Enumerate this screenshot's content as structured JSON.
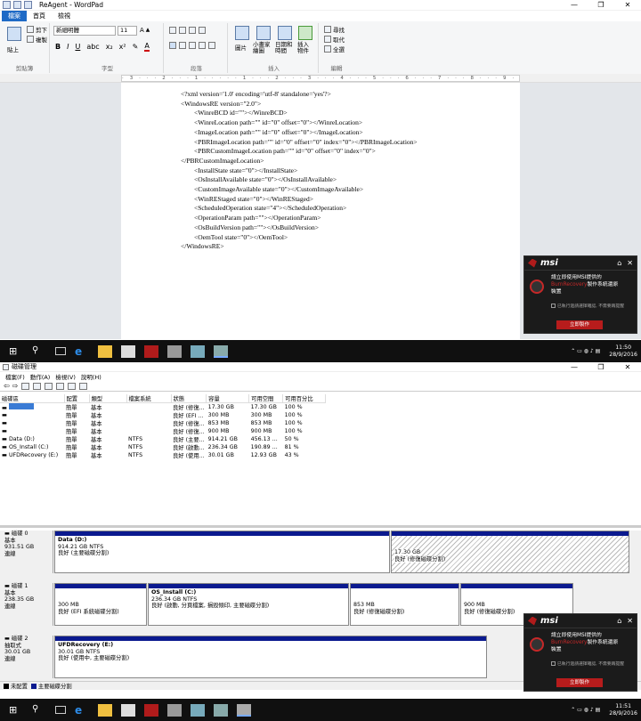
{
  "wordpad": {
    "title": "ReAgent - WordPad",
    "tabs": [
      "檔案",
      "首頁",
      "檢視"
    ],
    "ribbon": {
      "paste": "貼上",
      "cut": "剪下",
      "copy": "複製",
      "clipboard_group": "剪貼簿",
      "font_name": "新細明體",
      "font_size": "11",
      "font_group": "字型",
      "paragraph_group": "段落",
      "picture": "圖片",
      "paint": "小畫家\n繪圖",
      "datetime": "日期和\n時間",
      "insert_object": "插入\n物件",
      "insert_group": "插入",
      "find": "尋找",
      "replace": "取代",
      "select_all": "全選",
      "editing_group": "編輯"
    },
    "ruler": "· 3 · · · 2 · · · 1 · · · · · 1 · · · 2 · · · 3 · · · 4 · · · 5 · · · 6 · · · 7 · · · 8 · · · 9 · · · 10 · · · 11 · · · 12 · · · 13 · · · 14 · · · 15 · · · 16 · · · 17 · · ·",
    "document_lines": [
      "<?xml version='1.0' encoding='utf-8' standalone='yes'?>",
      "<WindowsRE version=\"2.0\">",
      "        <WinreBCD id=\"\"></WinreBCD>",
      "        <WinreLocation path=\"\" id=\"0\" offset=\"0\"></WinreLocation>",
      "        <ImageLocation path=\"\" id=\"0\" offset=\"0\"></ImageLocation>",
      "        <PBRImageLocation path=\"\" id=\"0\" offset=\"0\" index=\"0\"></PBRImageLocation>",
      "        <PBRCustomImageLocation path=\"\" id=\"0\" offset=\"0\" index=\"0\">",
      "</PBRCustomImageLocation>",
      "        <InstallState state=\"0\"></InstallState>",
      "        <OsInstallAvailable state=\"0\"></OsInstallAvailable>",
      "        <CustomImageAvailable state=\"0\"></CustomImageAvailable>",
      "        <WinREStaged state=\"0\"></WinREStaged>",
      "        <ScheduledOperation state=\"4\"></ScheduledOperation>",
      "        <OperationParam path=\"\"></OperationParam>",
      "        <OsBuildVersion path=\"\"></OsBuildVersion>",
      "        <OemTool state=\"0\"></OemTool>",
      "</WindowsRE>"
    ]
  },
  "taskbar1": {
    "time": "11:50",
    "date": "28/9/2016"
  },
  "taskbar2": {
    "time": "11:51",
    "date": "28/9/2016"
  },
  "msi_popup": {
    "logo": "msi",
    "line1": "請立即使用MSI提供的",
    "line2_red": "BurnRecovery",
    "line2": "製作系統還原",
    "line3": "裝置",
    "checkbox": "已執行過請選擇確認, 不需要再提醒",
    "button": "立即製作"
  },
  "diskmgmt": {
    "title": "磁碟管理",
    "menu": [
      "檔案(F)",
      "動作(A)",
      "檢視(V)",
      "說明(H)"
    ],
    "columns": [
      "磁碟區",
      "配置",
      "類型",
      "檔案系統",
      "狀態",
      "容量",
      "可用空間",
      "可用百分比"
    ],
    "rows": [
      [
        "",
        "簡單",
        "基本",
        "",
        "良好 (修復...",
        "17.30 GB",
        "17.30 GB",
        "100 %"
      ],
      [
        "",
        "簡單",
        "基本",
        "",
        "良好 (EFI ...",
        "300 MB",
        "300 MB",
        "100 %"
      ],
      [
        "",
        "簡單",
        "基本",
        "",
        "良好 (修復...",
        "853 MB",
        "853 MB",
        "100 %"
      ],
      [
        "",
        "簡單",
        "基本",
        "",
        "良好 (修復...",
        "900 MB",
        "900 MB",
        "100 %"
      ],
      [
        "Data (D:)",
        "簡單",
        "基本",
        "NTFS",
        "良好 (主要...",
        "914.21 GB",
        "456.13 ...",
        "50 %"
      ],
      [
        "OS_Install (C:)",
        "簡單",
        "基本",
        "NTFS",
        "良好 (啟動...",
        "236.34 GB",
        "190.89 ...",
        "81 %"
      ],
      [
        "UFDRecovery (E:)",
        "簡單",
        "基本",
        "NTFS",
        "良好 (使用...",
        "30.01 GB",
        "12.93 GB",
        "43 %"
      ]
    ],
    "disk0": {
      "name": "磁碟 0",
      "type": "基本",
      "size": "931.51 GB",
      "status": "連線",
      "p1": {
        "name": "Data  (D:)",
        "size": "914.21 GB NTFS",
        "status": "良好 (主要磁碟分割)"
      },
      "p2": {
        "size": "17.30 GB",
        "status": "良好 (修復磁碟分割)"
      }
    },
    "disk1": {
      "name": "磁碟 1",
      "type": "基本",
      "size": "238.35 GB",
      "status": "連線",
      "p1": {
        "size": "300 MB",
        "status": "良好 (EFI 系統磁碟分割)"
      },
      "p2": {
        "name": "OS_Install  (C:)",
        "size": "236.34 GB NTFS",
        "status": "良好 (啟動, 分頁檔案, 損毀傾印, 主要磁碟分割)"
      },
      "p3": {
        "size": "853 MB",
        "status": "良好 (修復磁碟分割)"
      },
      "p4": {
        "size": "900 MB",
        "status": "良好 (修復磁碟分割)"
      }
    },
    "disk2": {
      "name": "磁碟 2",
      "type": "抽取式",
      "size": "30.01 GB",
      "status": "連線",
      "p1": {
        "name": "UFDRecovery  (E:)",
        "size": "30.01 GB NTFS",
        "status": "良好 (使用中, 主要磁碟分割)"
      }
    },
    "legend": [
      "未配置",
      "主要磁碟分割"
    ]
  }
}
